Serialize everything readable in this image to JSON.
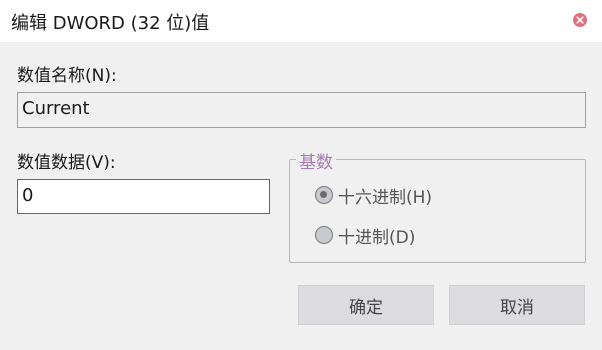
{
  "window": {
    "title": "编辑 DWORD (32 位)值",
    "close_icon": "close-icon"
  },
  "value_name": {
    "label": "数值名称(N):",
    "value": "Current"
  },
  "value_data": {
    "label": "数值数据(V):",
    "value": "0"
  },
  "base": {
    "legend": "基数",
    "options": [
      {
        "label": "十六进制(H)",
        "checked": true
      },
      {
        "label": "十进制(D)",
        "checked": false
      }
    ]
  },
  "buttons": {
    "ok": "确定",
    "cancel": "取消"
  },
  "colors": {
    "close_icon": "#e0707e",
    "legend": "#a77bb5",
    "data_field_border": "#b54448"
  }
}
